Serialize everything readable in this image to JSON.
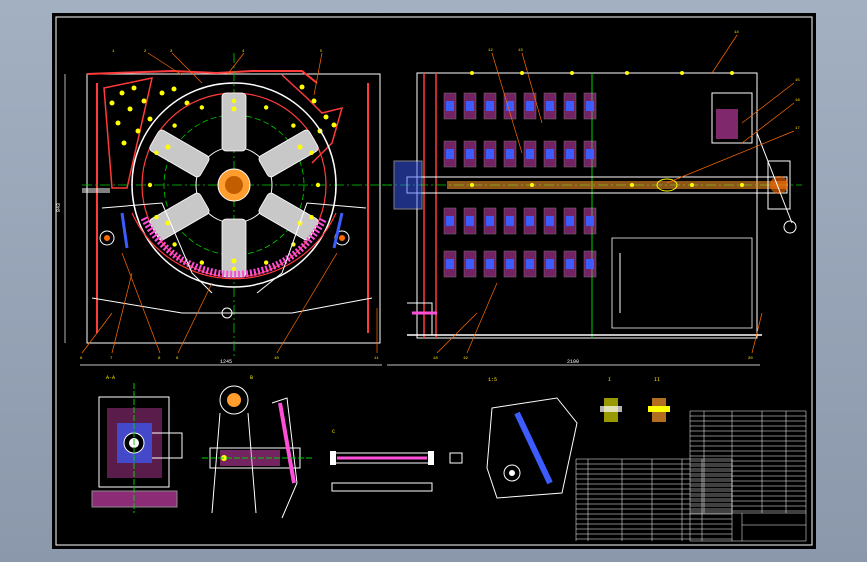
{
  "palette": {
    "background": "#000000",
    "outline": "#ffffff",
    "section": "#ff3b3b",
    "hatch": "#ff4fd8",
    "center": "#00d000",
    "dims": "#ffffff",
    "leader": "#ff6a00",
    "parts": "#3c5cff",
    "hole": "#ffff00",
    "notes": "#ffe600"
  },
  "labels": {
    "width_left": "1245",
    "width_right": "2100",
    "side_height": "843",
    "view_a": "A-A",
    "view_b": "B",
    "view_c": "C",
    "section_1": "I",
    "section_2": "II",
    "detail_a": "1:5"
  }
}
